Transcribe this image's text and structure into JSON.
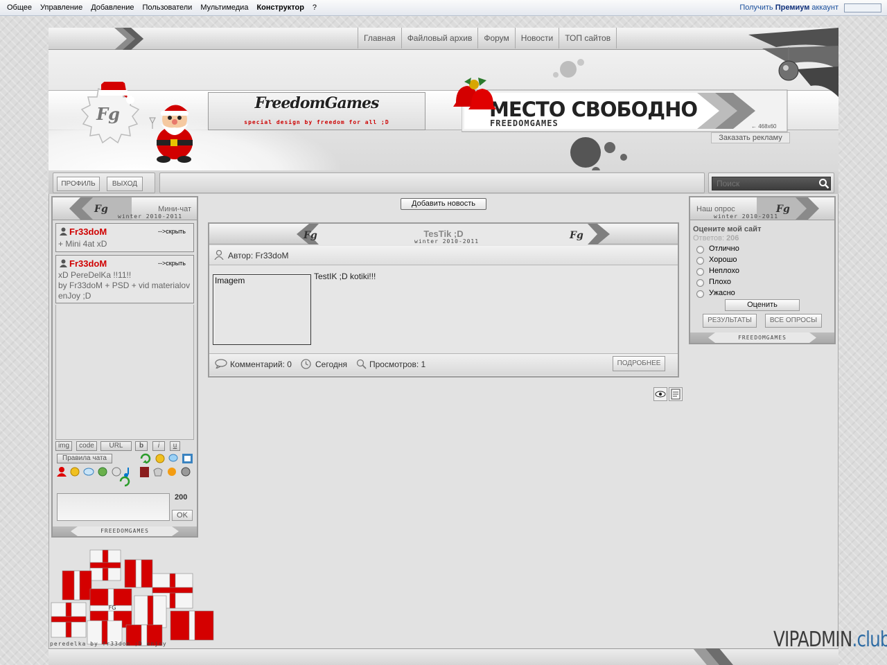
{
  "adminbar": {
    "menu": [
      "Общее",
      "Управление",
      "Добавление",
      "Пользователи",
      "Мультимедиа",
      "Конструктор",
      "?"
    ],
    "premium_prefix": "Получить",
    "premium_bold": "Премиум",
    "premium_suffix": "аккаунт"
  },
  "nav": {
    "items": [
      "Главная",
      "Файловый архив",
      "Форум",
      "Новости",
      "ТОП сайтов"
    ]
  },
  "header": {
    "logo_text": "FreedomGames",
    "logo_sub": "special design by freedom for all ;D",
    "badge_text": "Fg",
    "ad_title": "МЕСТО СВОБОДНО",
    "ad_sub": "FREEDOMGAMES",
    "ad_size": "← 468x60",
    "ad_order": "Заказать рекламу"
  },
  "toolbar": {
    "profile": "ПРОФИЛЬ",
    "logout": "ВЫХОД",
    "search_placeholder": "Поиск"
  },
  "chat": {
    "title": "Мини-чат",
    "sub": "winter 2010-2011",
    "hide_label": "-->скрыть",
    "messages": [
      {
        "user": "Fr33doM",
        "lines": [
          "+ Mini 4at xD"
        ]
      },
      {
        "user": "Fr33doM",
        "lines": [
          "xD PereDelKa !!11!!",
          "by Fr33doM + PSD + vid materialov",
          "enJoy ;D"
        ]
      }
    ],
    "bb": [
      "img",
      "code",
      "URL",
      "b",
      "i",
      "u"
    ],
    "rules": "Правила чата",
    "counter": "200",
    "ok": "OK",
    "footer": "FREEDOMGAMES"
  },
  "news": {
    "add_button": "Добавить новость",
    "title": "TesTik ;D",
    "sub": "winter 2010-2011",
    "author_label": "Автор: Fr33doM",
    "image_alt": "Imagem",
    "text": "TestIK ;D kotiki!!!",
    "comments": "Комментарий: 0",
    "date": "Сегодня",
    "views": "Просмотров: 1",
    "more": "ПОДРОБНЕЕ"
  },
  "poll": {
    "title": "Наш опрос",
    "sub": "winter 2010-2011",
    "question": "Оцените мой сайт",
    "answers_label": "Ответов:",
    "answers_count": "206",
    "options": [
      "Отлично",
      "Хорошо",
      "Неплохо",
      "Плохо",
      "Ужасно"
    ],
    "vote": "Оценить",
    "results": "РЕЗУЛЬТАТЫ",
    "all": "ВСЕ ОПРОСЫ",
    "footer": "FREEDOMGAMES"
  },
  "footer": {
    "credit": "peredelka by fr33dom ;D enjoy",
    "gift_label": "FG",
    "watermark_a": "VIPADMIN",
    "watermark_b": ".club"
  }
}
